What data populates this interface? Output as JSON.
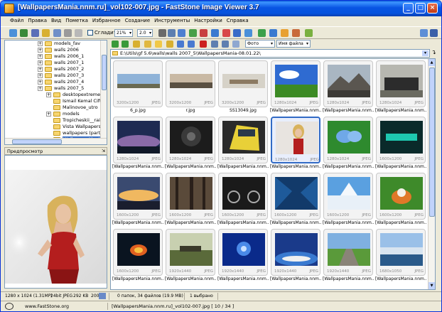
{
  "window": {
    "title": "[WallpapersMania.nnm.ru]_vol102-007.jpg  -  FastStone Image Viewer 3.7"
  },
  "menu": [
    "Файл",
    "Правка",
    "Вид",
    "Пометка",
    "Избранное",
    "Создание",
    "Инструменты",
    "Настройки",
    "Справка"
  ],
  "toolbar": {
    "smooth_label": "Сгладить",
    "zoom_value": "21%",
    "page_value": "2.0"
  },
  "tree": {
    "items": [
      {
        "label": "models_fav",
        "expandable": true,
        "level": 0
      },
      {
        "label": "walls 2006",
        "expandable": true,
        "level": 0
      },
      {
        "label": "walls 2006_1",
        "expandable": true,
        "level": 0
      },
      {
        "label": "walls 2007_1",
        "expandable": true,
        "level": 0
      },
      {
        "label": "walls 2007_2",
        "expandable": true,
        "level": 0
      },
      {
        "label": "walls 2007_3",
        "expandable": true,
        "level": 0
      },
      {
        "label": "walls 2007_4",
        "expandable": true,
        "level": 0
      },
      {
        "label": "walls 2007_5",
        "expandable": true,
        "level": 0
      },
      {
        "label": "desktopextreme.o...",
        "expandable": true,
        "level": 1
      },
      {
        "label": "Ismail Kemal Ciftci",
        "expandable": false,
        "level": 1
      },
      {
        "label": "Malinovoe_utro",
        "expandable": false,
        "level": 1
      },
      {
        "label": "models",
        "expandable": true,
        "level": 1
      },
      {
        "label": "Tropicheskii__rai",
        "expandable": false,
        "level": 1
      },
      {
        "label": "Vista Wallpapers(p",
        "expandable": false,
        "level": 1
      },
      {
        "label": "wallpapers (part 6",
        "expandable": false,
        "level": 1
      },
      {
        "label": "WallpapersMania",
        "expandable": false,
        "level": 1,
        "selected": true
      }
    ]
  },
  "preview": {
    "title": "Предпросмотр"
  },
  "nav": {
    "filter1": "Фото",
    "filter2": "Имя файла"
  },
  "address": {
    "path": "E:\\Utils\\gf 5.6\\walls\\walls 2007_5\\WallpapersMania-08.01.22\\"
  },
  "thumbnails": [
    {
      "name": "6_p.jpg",
      "size": "3200x1200",
      "format": "JPEG",
      "scene": "sky"
    },
    {
      "name": "r.jpg",
      "size": "3200x1200",
      "format": "JPEG",
      "scene": "dusk"
    },
    {
      "name": "SS13049.jpg",
      "size": "3200x1200",
      "format": "JPEG",
      "scene": "pale"
    },
    {
      "name": "[WallpapersMania.nnm...",
      "size": "1280x1024",
      "format": "JPEG",
      "scene": "field"
    },
    {
      "name": "[WallpapersMania.nnm...",
      "size": "1280x1024",
      "format": "JPEG",
      "scene": "mountain"
    },
    {
      "name": "[WallpapersMania.nnm...",
      "size": "1280x1024",
      "format": "JPEG",
      "scene": "train"
    },
    {
      "name": "[WallpapersMania.nnm...",
      "size": "1280x1024",
      "format": "JPEG",
      "scene": "nightsky"
    },
    {
      "name": "[WallpapersMania.nnm...",
      "size": "1280x1024",
      "format": "JPEG",
      "scene": "dark"
    },
    {
      "name": "[WallpapersMania.nnm...",
      "size": "1280x1024",
      "format": "JPEG",
      "scene": "tram"
    },
    {
      "name": "[WallpapersMania.nnm...",
      "size": "1280x1024",
      "format": "JPEG",
      "scene": "girl",
      "selected": true
    },
    {
      "name": "[WallpapersMania.nnm...",
      "size": "1280x1024",
      "format": "JPEG",
      "scene": "butterfly"
    },
    {
      "name": "[WallpapersMania.nnm...",
      "size": "1600x1200",
      "format": "JPEG",
      "scene": "teal"
    },
    {
      "name": "[WallpapersMania.nnm...",
      "size": "1600x1200",
      "format": "JPEG",
      "scene": "clouds"
    },
    {
      "name": "[WallpapersMania.nnm...",
      "size": "1600x1200",
      "format": "JPEG",
      "scene": "forest"
    },
    {
      "name": "[WallpapersMania.nnm...",
      "size": "1600x1200",
      "format": "JPEG",
      "scene": "moto"
    },
    {
      "name": "[WallpapersMania.nnm...",
      "size": "1600x1200",
      "format": "JPEG",
      "scene": "cave"
    },
    {
      "name": "[WallpapersMania.nnm...",
      "size": "1600x1200",
      "format": "JPEG",
      "scene": "snow"
    },
    {
      "name": "[WallpapersMania.nnm...",
      "size": "1600x1200",
      "format": "JPEG",
      "scene": "fox"
    },
    {
      "name": "[WallpapersMania.nnm...",
      "size": "1600x1200",
      "format": "JPEG",
      "scene": "fire"
    },
    {
      "name": "[WallpapersMania.nnm...",
      "size": "1920x1440",
      "format": "JPEG",
      "scene": "cannon"
    },
    {
      "name": "[WallpapersMania.nnm...",
      "size": "1920x1440",
      "format": "JPEG",
      "scene": "blue"
    },
    {
      "name": "[WallpapersMania.nnm...",
      "size": "1920x1440",
      "format": "JPEG",
      "scene": "earth"
    },
    {
      "name": "[WallpapersMania.nnm...",
      "size": "1920x1440",
      "format": "JPEG",
      "scene": "road"
    },
    {
      "name": "[WallpapersMania.nnm...",
      "size": "1680x1050",
      "format": "JPEG",
      "scene": "lake"
    }
  ],
  "status": {
    "dimensions": "1280 x 1024 (1.31MP)",
    "depth_format": "24bit JPEG",
    "filesize": "292 KB",
    "zoom": "200",
    "folder_info": "0 папок, 34 файлов (19.9 MB)",
    "selected": "1 выбрано",
    "website": "www.FastStone.org",
    "file_info": "[WallpapersMania.nnm.ru]_vol102-007.jpg [ 10 / 34 ]"
  },
  "colors": {
    "titlebar": "#0854e3",
    "selection": "#316ac5",
    "panel_bg": "#ece9d8"
  }
}
